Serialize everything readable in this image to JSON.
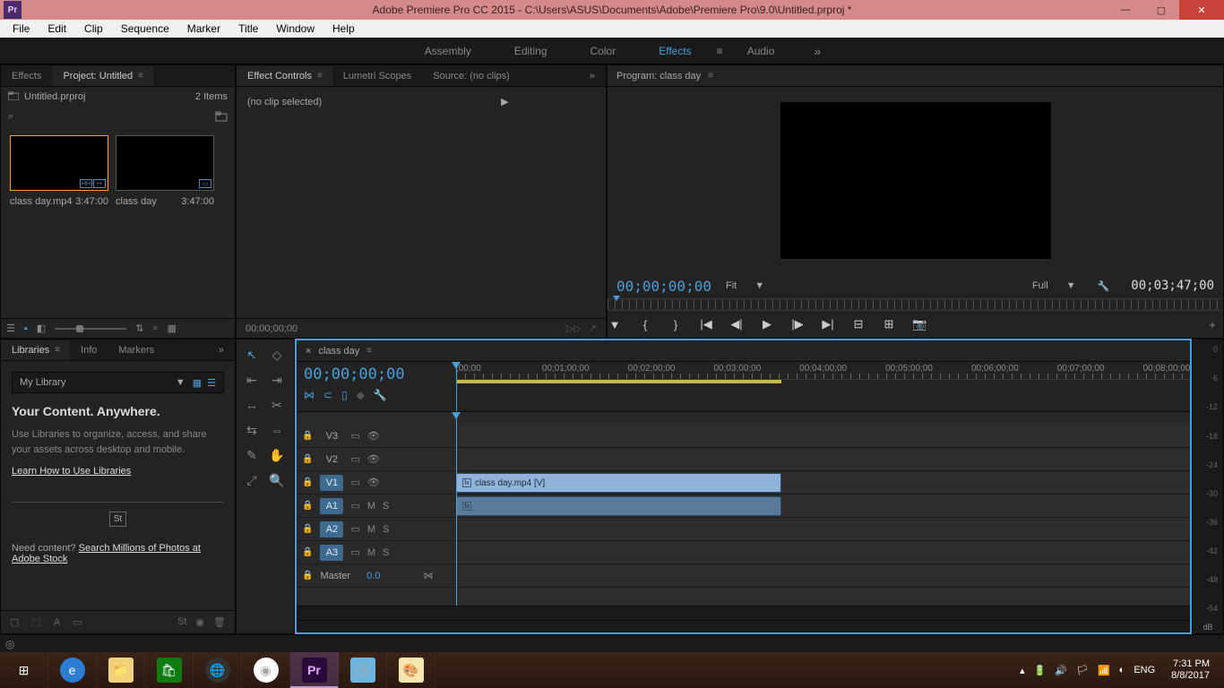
{
  "title_bar": {
    "app_badge": "Pr",
    "title": "Adobe Premiere Pro CC 2015 - C:\\Users\\ASUS\\Documents\\Adobe\\Premiere Pro\\9.0\\Untitled.prproj *"
  },
  "menu": [
    "File",
    "Edit",
    "Clip",
    "Sequence",
    "Marker",
    "Title",
    "Window",
    "Help"
  ],
  "workspaces": {
    "items": [
      "Assembly",
      "Editing",
      "Color",
      "Effects",
      "Audio"
    ],
    "active": "Effects"
  },
  "project": {
    "tabs": {
      "effects": "Effects",
      "project": "Project: Untitled"
    },
    "bin": "Untitled.prproj",
    "item_count": "2 Items",
    "items": [
      {
        "name": "class day.mp4",
        "duration": "3:47:00",
        "badges": [
          "HH",
          "↦"
        ]
      },
      {
        "name": "class day",
        "duration": "3:47:00",
        "badges": [
          "▭"
        ]
      }
    ]
  },
  "effect_controls": {
    "tabs": {
      "ec": "Effect Controls",
      "lumetri": "Lumetri Scopes",
      "source": "Source: (no clips)"
    },
    "no_clip": "(no clip selected)",
    "timecode": "00;00;00;00"
  },
  "program": {
    "title": "Program: class day",
    "timecode": "00;00;00;00",
    "fit": "Fit",
    "full": "Full",
    "duration": "00;03;47;00"
  },
  "libraries": {
    "tabs": {
      "lib": "Libraries",
      "info": "Info",
      "markers": "Markers"
    },
    "dropdown": "My Library",
    "heading": "Your Content. Anywhere.",
    "body": "Use Libraries to organize, access, and share your assets across desktop and mobile.",
    "learn_link": "Learn How to Use Libraries",
    "stock_badge": "St",
    "need_pre": "Need content?  ",
    "need_link": "Search Millions of Photos at Adobe Stock"
  },
  "timeline": {
    "header": "class day",
    "timecode": "00;00;00;00",
    "ruler": [
      {
        "label": ";00;00",
        "pct": 0
      },
      {
        "label": "00;01;00;00",
        "pct": 11.7
      },
      {
        "label": "00;02;00;00",
        "pct": 23.4
      },
      {
        "label": "00;03;00;00",
        "pct": 35.1
      },
      {
        "label": "00;04;00;00",
        "pct": 46.8
      },
      {
        "label": "00;05;00;00",
        "pct": 58.5
      },
      {
        "label": "00;06;00;00",
        "pct": 70.2
      },
      {
        "label": "00;07;00;00",
        "pct": 81.9
      },
      {
        "label": "00;08;00;00",
        "pct": 93.6
      }
    ],
    "workarea_end_pct": 44.3,
    "playhead_pct": 0,
    "clip_end_pct": 44.3,
    "tracks": {
      "v3": "V3",
      "v2": "V2",
      "v1": "V1",
      "a1": "A1",
      "a2": "A2",
      "a3": "A3",
      "master": "Master",
      "master_val": "0.0",
      "m": "M",
      "s": "S"
    },
    "clip_label": "class day.mp4 [V]"
  },
  "meter": {
    "ticks": [
      "0",
      "-6",
      "-12",
      "-18",
      "-24",
      "-30",
      "-36",
      "-42",
      "-48",
      "-54"
    ],
    "unit": "dB"
  },
  "taskbar": {
    "lang": "ENG",
    "time": "7:31 PM",
    "date": "8/8/2017"
  }
}
